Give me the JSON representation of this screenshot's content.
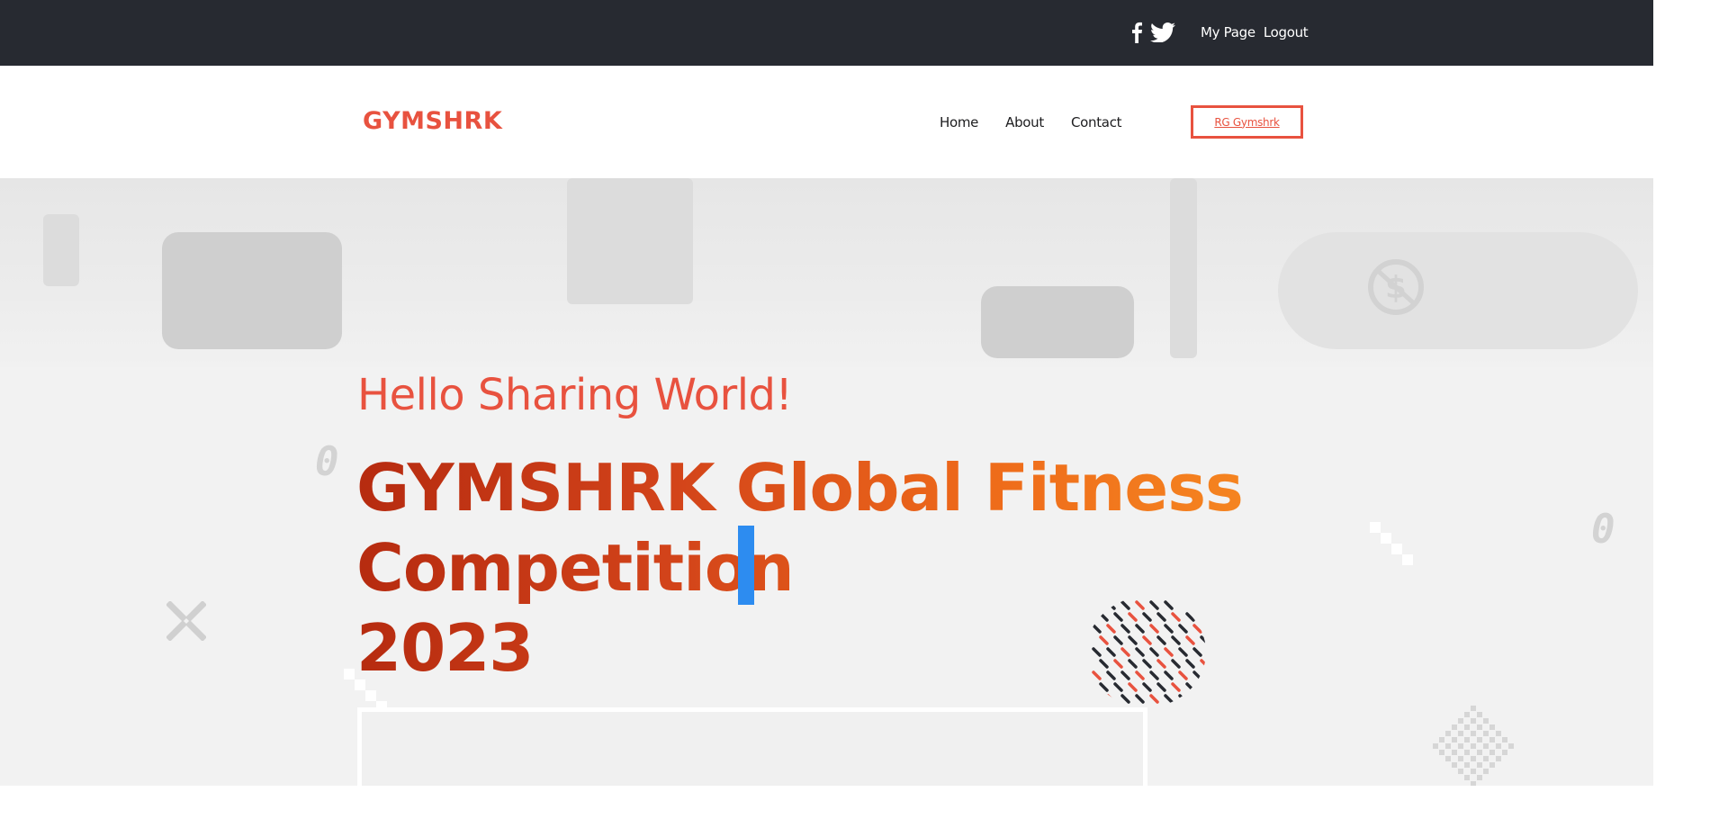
{
  "topbar": {
    "social": [
      {
        "icon": "facebook-icon"
      },
      {
        "icon": "twitter-icon"
      }
    ],
    "links": [
      {
        "label": "My Page"
      },
      {
        "label": "Logout"
      }
    ]
  },
  "header": {
    "logo": "GYMSHRK",
    "nav": [
      {
        "label": "Home"
      },
      {
        "label": "About"
      },
      {
        "label": "Contact"
      }
    ],
    "cta_label": "RG Gymshrk"
  },
  "hero": {
    "greeting": "Hello Sharing World!",
    "title_line1": "GYMSHRK Global Fitness",
    "title_line2": "Competition",
    "title_line3": "2023"
  },
  "colors": {
    "accent": "#e8523f",
    "topbar_bg": "#272a31",
    "caret": "#2d8cf0"
  }
}
